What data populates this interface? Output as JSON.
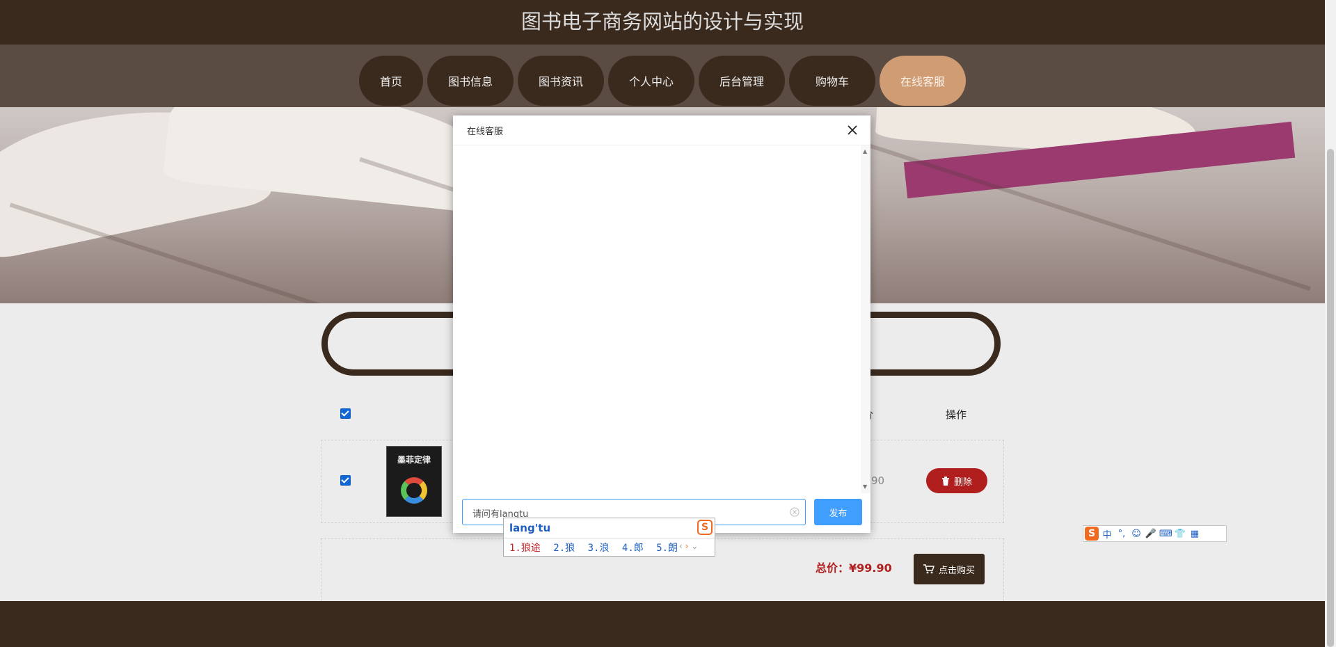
{
  "site": {
    "title": "图书电子商务网站的设计与实现"
  },
  "nav": {
    "items": [
      {
        "label": "首页"
      },
      {
        "label": "图书信息"
      },
      {
        "label": "图书资讯"
      },
      {
        "label": "个人中心"
      },
      {
        "label": "后台管理"
      },
      {
        "label": "购物车"
      },
      {
        "label": "在线客服",
        "active": true
      }
    ]
  },
  "cart": {
    "header_partial_price": "价",
    "header_action": "操作",
    "row": {
      "book_title": "墨菲定律",
      "price_partial": "90",
      "delete_label": "删除"
    },
    "total_label": "总价：",
    "total_value": "¥99.90",
    "buy_label": "点击购买"
  },
  "modal": {
    "title": "在线客服",
    "input_value": "请问有langtu",
    "send_label": "发布"
  },
  "ime": {
    "code": "lang'tu",
    "candidates": [
      "1.狼途",
      "2.狼",
      "3.浪",
      "4.郎",
      "5.朗"
    ],
    "toolbar": [
      "中",
      "°,",
      "☺",
      "🎤",
      "⌨",
      "👕",
      "▦"
    ]
  },
  "colors": {
    "brand_dark": "#3a2a1e",
    "nav_active": "#d09c74",
    "delete_red": "#b01e1e",
    "primary_blue": "#409eff"
  }
}
